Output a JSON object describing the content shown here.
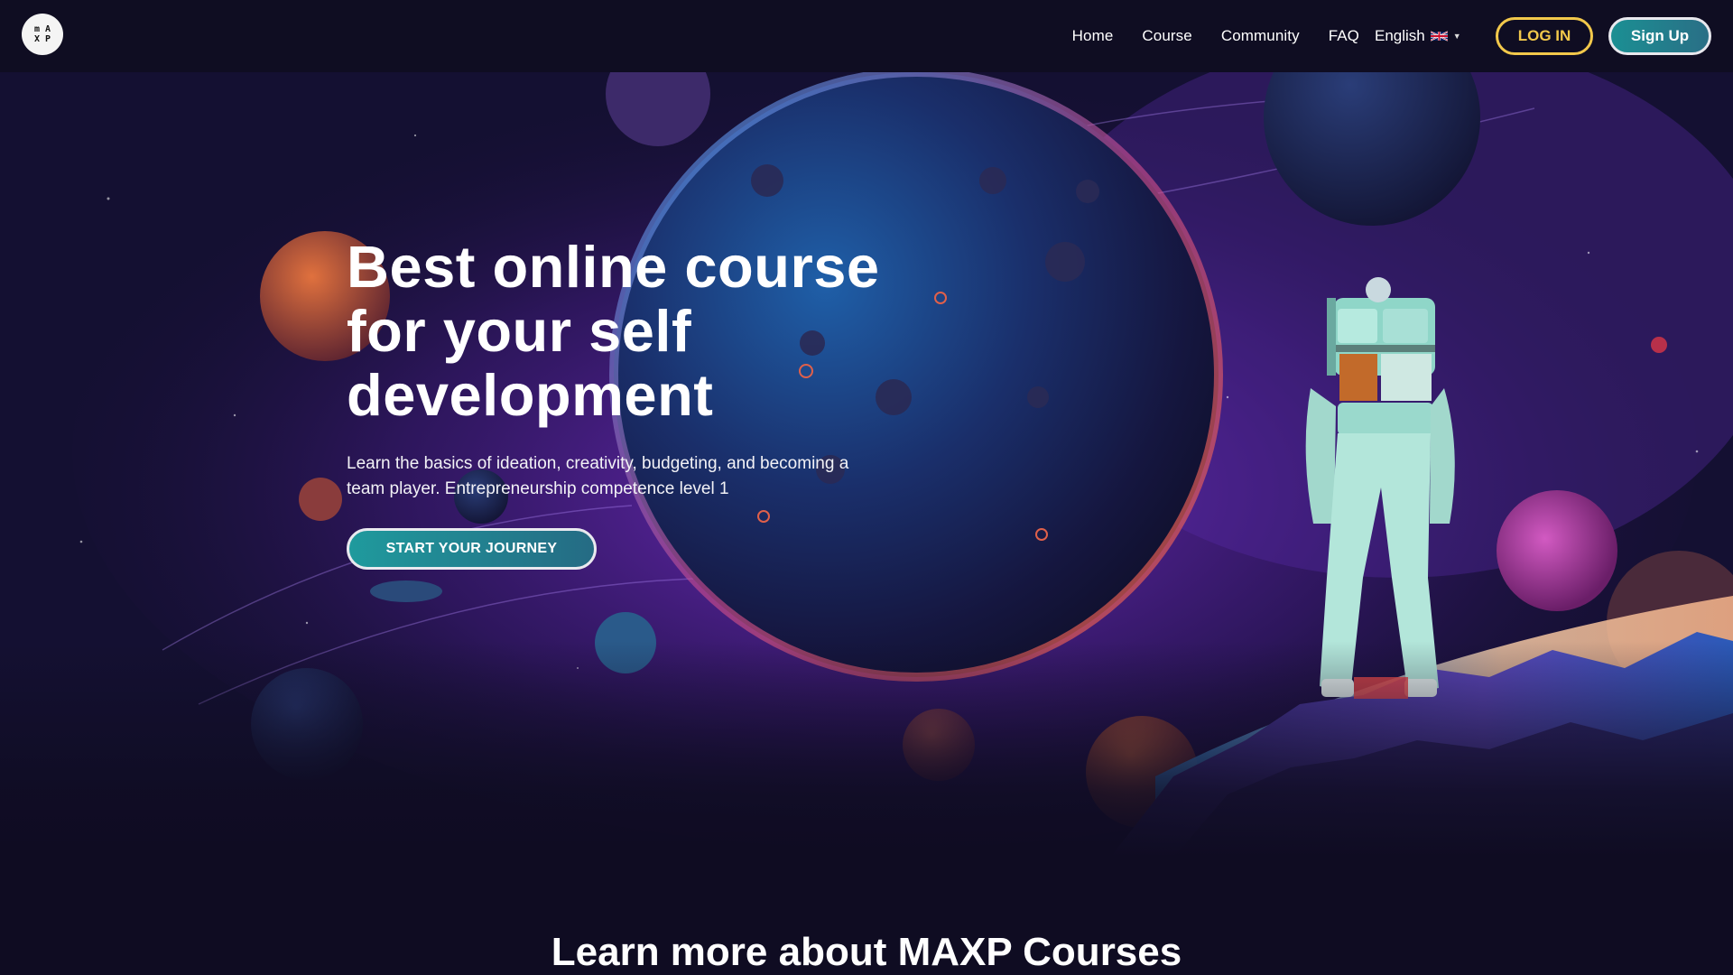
{
  "brand": {
    "logo_letters": [
      "m",
      "A",
      "X",
      "P"
    ]
  },
  "nav": {
    "links": [
      "Home",
      "Course",
      "Community",
      "FAQ"
    ],
    "language": "English",
    "login_label": "LOG IN",
    "signup_label": "Sign Up"
  },
  "hero": {
    "title": "Best online course for your self development",
    "subtitle": "Learn the basics of ideation, creativity, budgeting, and becoming a team player. Entrepreneurship competence level 1",
    "cta_label": "START YOUR JOURNEY"
  },
  "section": {
    "title": "Learn more about MAXP Courses"
  },
  "colors": {
    "background": "#0f0c22",
    "login_accent": "#f2c84b",
    "cta_teal": "#1f9a9d",
    "nebula_purple": "#8a2fd6"
  },
  "icons": {
    "language_flag": "uk-flag-icon",
    "language_caret": "caret-down-icon"
  }
}
